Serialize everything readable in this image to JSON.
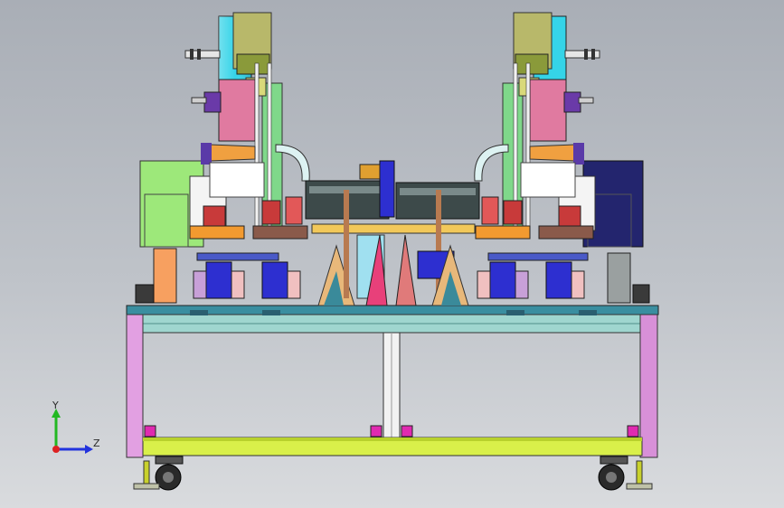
{
  "viewport": {
    "triad": {
      "x_label": "",
      "y_label": "Y",
      "z_label": "Z"
    }
  },
  "colors": {
    "background_top": "#a9aeb6",
    "background_bottom": "#d9dbde",
    "frame_teal": "#9fd6cf",
    "frame_pink": "#e2a0e2",
    "base_yellow": "#d9f04a",
    "motor_cyan": "#35d4e8",
    "block_pink": "#e07aa0",
    "cylinder_orange": "#f0a040",
    "panel_green": "#9de87a",
    "panel_navy": "#23256e",
    "clamp_blue": "#2d2fd0",
    "magenta_foot": "#e02ab0"
  }
}
